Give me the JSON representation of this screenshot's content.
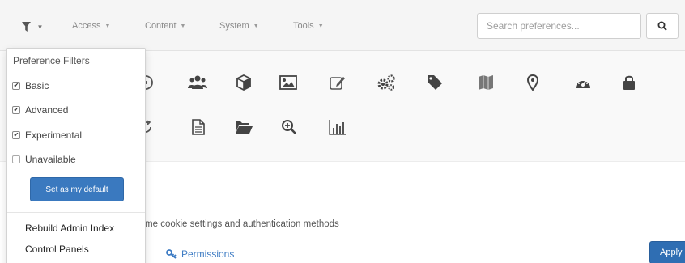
{
  "topbar": {
    "filter_icon": "filter-icon",
    "nav": [
      {
        "label": "Access"
      },
      {
        "label": "Content"
      },
      {
        "label": "System"
      },
      {
        "label": "Tools"
      }
    ],
    "search": {
      "placeholder": "Search preferences...",
      "icon": "search-icon"
    }
  },
  "icons": [
    "circle-icon",
    "users-icon",
    "cube-icon",
    "image-icon",
    "edit-icon",
    "cogs-icon",
    "tag-icon",
    "map-icon",
    "map-marker-icon",
    "dashboard-icon",
    "lock-icon",
    "refresh-icon",
    "file-text-icon",
    "folder-open-icon",
    "zoom-in-icon",
    "bar-chart-icon"
  ],
  "main": {
    "description": "r me cookie settings and authentication methods",
    "partial_link": "s",
    "permissions_label": "Permissions",
    "apply_label": "Apply"
  },
  "dropdown": {
    "header": "Preference Filters",
    "checkboxes": [
      {
        "label": "Basic",
        "checked": true
      },
      {
        "label": "Advanced",
        "checked": true
      },
      {
        "label": "Experimental",
        "checked": true
      },
      {
        "label": "Unavailable",
        "checked": false
      }
    ],
    "set_default_label": "Set as my default",
    "items": [
      {
        "label": "Rebuild Admin Index"
      },
      {
        "label": "Control Panels"
      }
    ]
  },
  "colors": {
    "primary": "#3a79bf",
    "link": "#3e7cc4",
    "topbar_bg": "#f5f5f5"
  }
}
